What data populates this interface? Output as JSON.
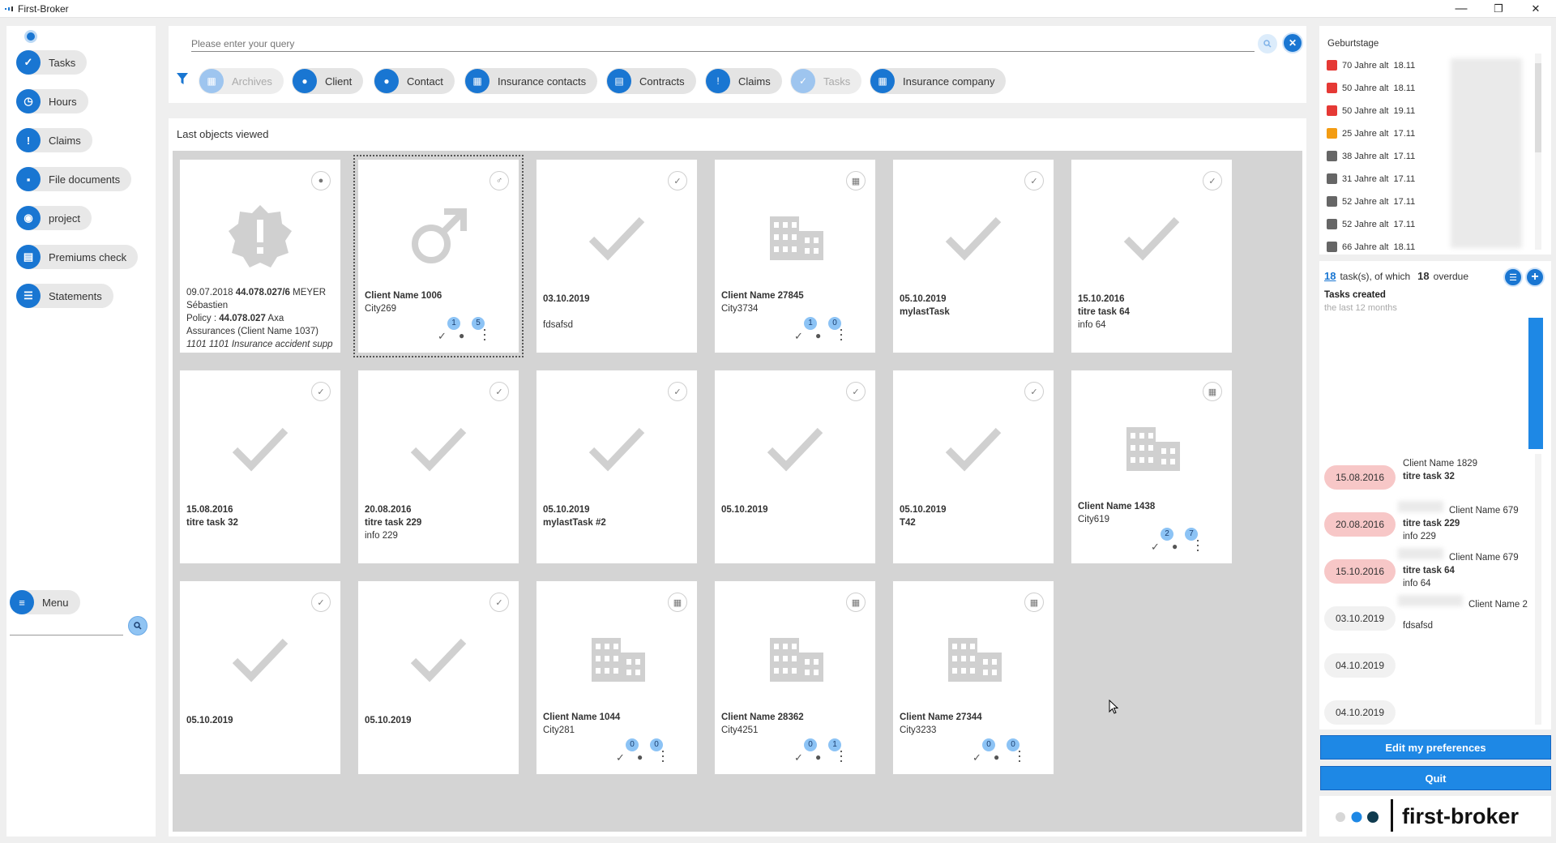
{
  "window": {
    "title": "First-Broker",
    "minimize": "—",
    "maximize": "❐",
    "close": "✕"
  },
  "colors": {
    "accent": "#1976d2",
    "accent_light": "#9ec5ef",
    "overdue": "#f7c7c7",
    "button": "#1e88e5"
  },
  "left_nav": {
    "items": [
      {
        "label": "Tasks",
        "icon": "check-icon"
      },
      {
        "label": "Hours",
        "icon": "clock-icon"
      },
      {
        "label": "Claims",
        "icon": "alert-icon"
      },
      {
        "label": "File documents",
        "icon": "folder-icon"
      },
      {
        "label": "project",
        "icon": "eye-icon"
      },
      {
        "label": "Premiums check",
        "icon": "document-icon"
      },
      {
        "label": "Statements",
        "icon": "list-check-icon"
      }
    ],
    "menu_label": "Menu",
    "search_placeholder": ""
  },
  "search": {
    "placeholder": "Please enter your query"
  },
  "filters": [
    {
      "label": "Archives",
      "active": false
    },
    {
      "label": "Client",
      "active": true
    },
    {
      "label": "Contact",
      "active": true
    },
    {
      "label": "Insurance contacts",
      "active": true
    },
    {
      "label": "Contracts",
      "active": true
    },
    {
      "label": "Claims",
      "active": true
    },
    {
      "label": "Tasks",
      "active": false
    },
    {
      "label": "Insurance company",
      "active": true
    }
  ],
  "recent": {
    "title": "Last objects viewed",
    "cards": [
      {
        "type": "claim",
        "l1": "09.07.2018",
        "l1b": "44.078.027/6",
        "l1c": "MEYER",
        "l2": "Sébastien",
        "l3": "Policy :",
        "l3b": "44.078.027",
        "l3c": "Axa",
        "l4": "Assurances (Client Name 1037)",
        "l5": "1101 1101 Insurance accident supp"
      },
      {
        "type": "client",
        "title": "Client Name 1006",
        "sub": "City269",
        "b1": "1",
        "b2": "5"
      },
      {
        "type": "task",
        "title": "03.10.2019",
        "sub2": "fdsafsd"
      },
      {
        "type": "company",
        "title": "Client Name 27845",
        "sub": "City3734",
        "b1": "1",
        "b2": "0"
      },
      {
        "type": "task",
        "title": "05.10.2019",
        "title2": "mylastTask"
      },
      {
        "type": "task",
        "title": "15.10.2016",
        "title2": "titre task 64",
        "sub": "info 64"
      },
      {
        "type": "task",
        "title": "15.08.2016",
        "title2": "titre task 32"
      },
      {
        "type": "task",
        "title": "20.08.2016",
        "title2": "titre task 229",
        "sub": "info 229"
      },
      {
        "type": "task",
        "title": "05.10.2019",
        "title2": "mylastTask #2"
      },
      {
        "type": "task",
        "title": "05.10.2019"
      },
      {
        "type": "task",
        "title": "05.10.2019",
        "title2": "T42"
      },
      {
        "type": "company",
        "title": "Client Name 1438",
        "sub": "City619",
        "b1": "2",
        "b2": "7"
      },
      {
        "type": "task",
        "title": "05.10.2019"
      },
      {
        "type": "task",
        "title": "05.10.2019"
      },
      {
        "type": "company",
        "title": "Client Name 1044",
        "sub": "City281",
        "b1": "0",
        "b2": "0"
      },
      {
        "type": "company",
        "title": "Client Name 28362",
        "sub": "City4251",
        "b1": "0",
        "b2": "1"
      },
      {
        "type": "company",
        "title": "Client Name 27344",
        "sub": "City3233",
        "b1": "0",
        "b2": "0"
      }
    ]
  },
  "birthdays": {
    "title": "Geburtstage",
    "items": [
      {
        "text": "70 Jahre alt",
        "date": "18.11",
        "color": "#e53935"
      },
      {
        "text": "50 Jahre alt",
        "date": "18.11",
        "color": "#e53935"
      },
      {
        "text": "50 Jahre alt",
        "date": "19.11",
        "color": "#e53935"
      },
      {
        "text": "25 Jahre alt",
        "date": "17.11",
        "color": "#f39c12"
      },
      {
        "text": "38 Jahre alt",
        "date": "17.11",
        "color": "#666666"
      },
      {
        "text": "31 Jahre alt",
        "date": "17.11",
        "color": "#666666"
      },
      {
        "text": "52 Jahre alt",
        "date": "17.11",
        "color": "#666666"
      },
      {
        "text": "52 Jahre alt",
        "date": "17.11",
        "color": "#666666"
      },
      {
        "text": "66 Jahre alt",
        "date": "18.11",
        "color": "#666666"
      }
    ]
  },
  "tasks_summary": {
    "count": "18",
    "text": "task(s), of which",
    "overdue_count": "18",
    "overdue_text": "overdue",
    "created_title": "Tasks created",
    "created_sub": "the last 12 months"
  },
  "timeline": [
    {
      "date": "15.08.2016",
      "overdue": true,
      "client": "Client Name 1829",
      "title": "titre task 32",
      "info": ""
    },
    {
      "date": "20.08.2016",
      "overdue": true,
      "client": "Client Name 679",
      "title": "titre task 229",
      "info": "info 229"
    },
    {
      "date": "15.10.2016",
      "overdue": true,
      "client": "Client Name 679",
      "title": "titre task 64",
      "info": "info 64"
    },
    {
      "date": "03.10.2019",
      "overdue": false,
      "client": "Client Name 2",
      "title": "",
      "info": "fdsafsd"
    },
    {
      "date": "04.10.2019",
      "overdue": false,
      "client": "",
      "title": "",
      "info": ""
    },
    {
      "date": "04.10.2019",
      "overdue": false,
      "client": "",
      "title": "",
      "info": ""
    }
  ],
  "buttons": {
    "preferences": "Edit my preferences",
    "quit": "Quit"
  },
  "brand": {
    "name": "first-broker"
  }
}
